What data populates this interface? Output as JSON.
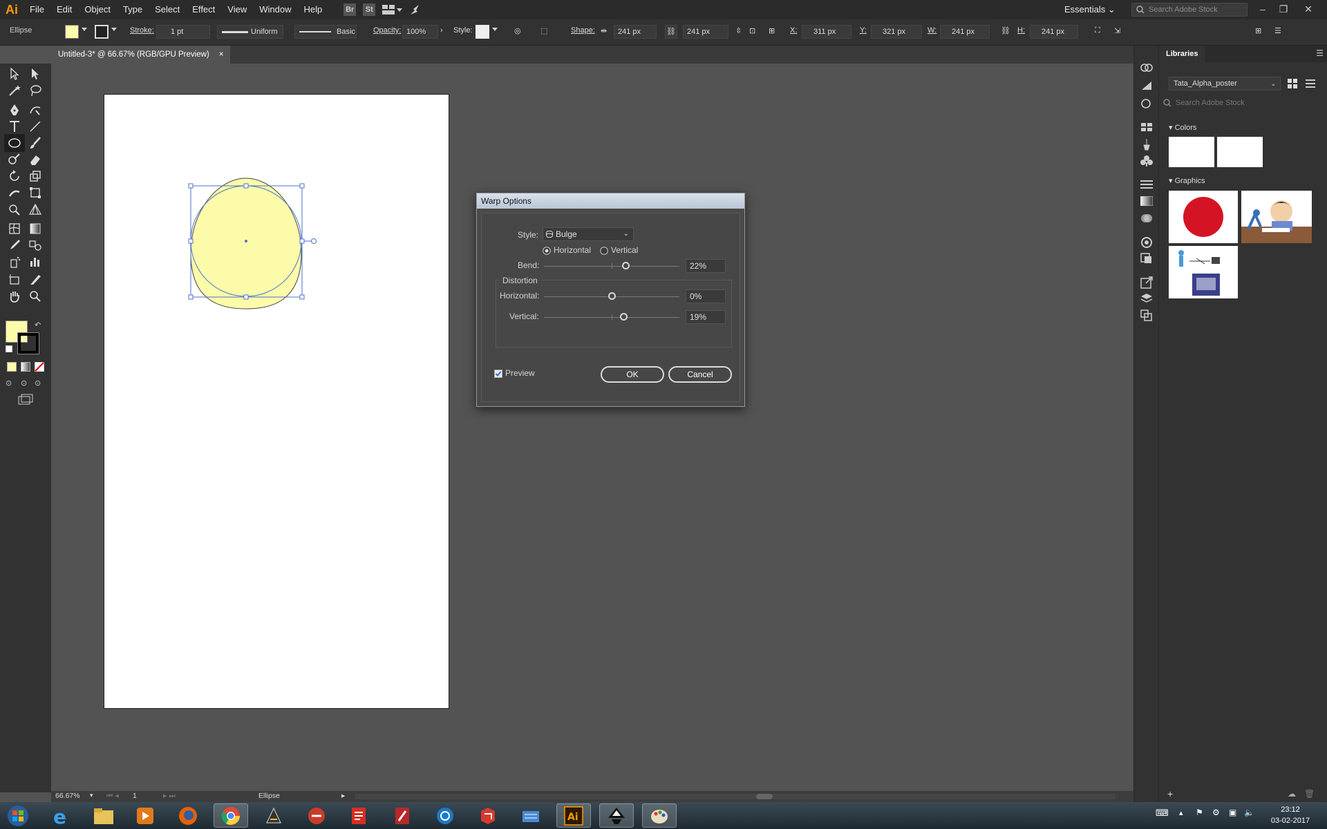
{
  "menubar": {
    "logo": "Ai",
    "items": [
      "File",
      "Edit",
      "Object",
      "Type",
      "Select",
      "Effect",
      "View",
      "Window",
      "Help"
    ],
    "bridge_icon": "Br",
    "stock_icon": "St",
    "workspace": "Essentials",
    "search_placeholder": "Search Adobe Stock"
  },
  "control_bar": {
    "selection_type": "Ellipse",
    "fill_color": "#fbfbaa",
    "stroke_label": "Stroke:",
    "stroke_weight": "1 pt",
    "stroke_profile": "Uniform",
    "brush": "Basic",
    "opacity_label": "Opacity:",
    "opacity": "100%",
    "style_label": "Style:",
    "shape_label": "Shape:",
    "shape_w": "241 px",
    "shape_h": "241 px",
    "x_label": "X:",
    "x": "311 px",
    "y_label": "Y:",
    "y": "321 px",
    "w_label": "W:",
    "w": "241 px",
    "h_label": "H:",
    "h": "241 px"
  },
  "document_tab": {
    "title": "Untitled-3* @ 66.67% (RGB/GPU Preview)",
    "close": "×"
  },
  "toolbar": {
    "fill_color": "#fbfbaa",
    "stroke_color": "#000000"
  },
  "status_bar": {
    "zoom": "66.67%",
    "artboard": "1",
    "info": "Ellipse"
  },
  "libraries_panel": {
    "tab": "Libraries",
    "library_name": "Tata_Alpha_poster",
    "search_placeholder": "Search Adobe Stock",
    "colors_section": "Colors",
    "graphics_section": "Graphics"
  },
  "warp_dialog": {
    "title": "Warp Options",
    "style_label": "Style:",
    "style_value": "Bulge",
    "horizontal_option": "Horizontal",
    "vertical_option": "Vertical",
    "orientation_selected": "Horizontal",
    "bend_label": "Bend:",
    "bend_value": "22%",
    "distortion_label": "Distortion",
    "dist_horizontal_label": "Horizontal:",
    "dist_horizontal_value": "0%",
    "dist_vertical_label": "Vertical:",
    "dist_vertical_value": "19%",
    "preview_label": "Preview",
    "preview_checked": true,
    "ok_label": "OK",
    "cancel_label": "Cancel"
  },
  "taskbar": {
    "time": "23:12",
    "date": "03-02-2017"
  }
}
